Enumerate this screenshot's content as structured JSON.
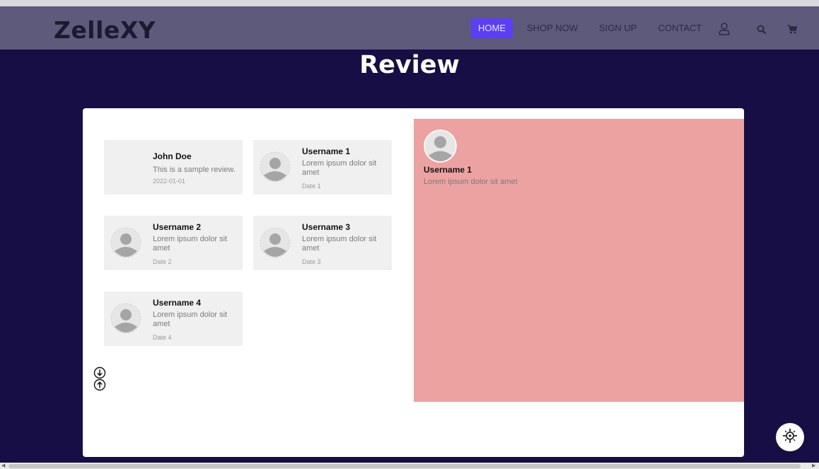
{
  "brand": {
    "logo": "ZelleXY"
  },
  "nav": {
    "items": [
      {
        "label": "HOME"
      },
      {
        "label": "SHOP NOW"
      },
      {
        "label": "SIGN UP"
      },
      {
        "label": "CONTACT"
      }
    ],
    "icons": [
      "user-icon",
      "search-icon",
      "cart-icon"
    ]
  },
  "page": {
    "title": "Review"
  },
  "reviews": [
    {
      "username": "John Doe",
      "text": "This is a sample review.",
      "date": "2022-01-01"
    },
    {
      "username": "Username 1",
      "text": "Lorem ipsum dolor sit amet",
      "date": "Date 1"
    },
    {
      "username": "Username 2",
      "text": "Lorem ipsum dolor sit amet",
      "date": "Date 2"
    },
    {
      "username": "Username 3",
      "text": "Lorem ipsum dolor sit amet",
      "date": "Date 3"
    },
    {
      "username": "Username 4",
      "text": "Lorem ipsum dolor sit amet",
      "date": "Date 4"
    }
  ],
  "selected_review": {
    "username": "Username 1",
    "text": "Lorem ipsum dolor sit amet"
  },
  "colors": {
    "background": "#170e45",
    "navbar": "#5e5a7c",
    "active_nav": "#5b3ef6",
    "detail_panel": "#eda2a2",
    "card": "#f0f0f0"
  }
}
